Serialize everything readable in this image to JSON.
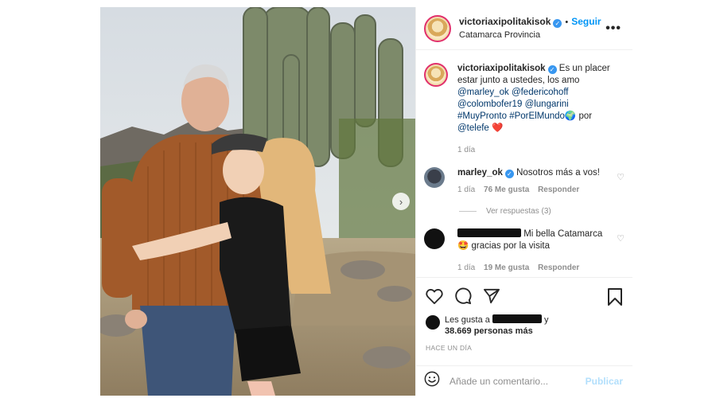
{
  "post": {
    "username": "victoriaxipolitakisok",
    "follow_label": "Seguir",
    "separator": "•",
    "location": "Catamarca Provincia",
    "more_label": "•••"
  },
  "caption": {
    "username": "victoriaxipolitakisok",
    "text_start": "Es un placer estar junto a ustedes, los amo",
    "mentions": [
      "@marley_ok",
      "@federicohoff",
      "@colombofer19",
      "@lungarini"
    ],
    "hashtags": [
      "#MuyPronto",
      "#PorElMundo"
    ],
    "globe": "🌍",
    "por": "por",
    "telefe": "@telefe",
    "heart": "❤️",
    "time": "1 día"
  },
  "comments": [
    {
      "username": "marley_ok",
      "text": "Nosotros más a vos!",
      "time": "1 día",
      "likes": "76 Me gusta",
      "reply": "Responder",
      "replies_label": "Ver respuestas (3)"
    },
    {
      "username": "",
      "text": "Mi bella Catamarca",
      "text2": "gracias por la visita",
      "emoji": "🤩",
      "time": "1 día",
      "likes": "19 Me gusta",
      "reply": "Responder"
    }
  ],
  "likes": {
    "prefix": "Les gusta a",
    "suffix": "y",
    "count": "38.669 personas más"
  },
  "time_ago": "HACE UN DÍA",
  "add_comment": {
    "placeholder": "Añade un comentario...",
    "publish": "Publicar"
  },
  "icons": {
    "next": "›",
    "heart_small": "♡",
    "emoji": "☺"
  },
  "colors": {
    "link": "#0095f6",
    "mention": "#00376b",
    "verified": "#3897f0"
  }
}
